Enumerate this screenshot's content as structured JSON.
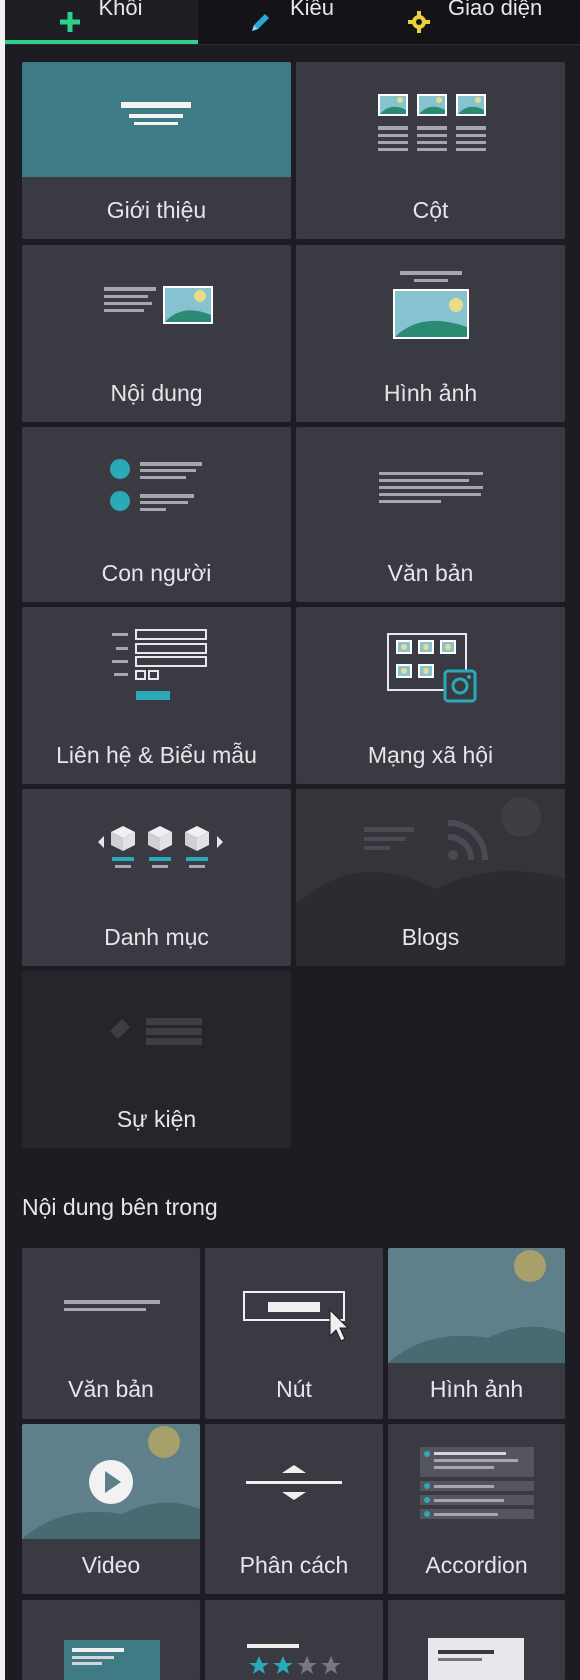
{
  "tabs": [
    {
      "label": "Khối",
      "icon": "plus-icon",
      "active": true
    },
    {
      "label": "Kiểu",
      "icon": "pencil-icon",
      "active": false
    },
    {
      "label": "Giao diện",
      "icon": "gear-icon",
      "active": false
    }
  ],
  "blocks": [
    {
      "label": "Giới thiệu"
    },
    {
      "label": "Cột"
    },
    {
      "label": "Nội dung"
    },
    {
      "label": "Hình ảnh"
    },
    {
      "label": "Con người"
    },
    {
      "label": "Văn bản"
    },
    {
      "label": "Liên hệ & Biểu mẫu"
    },
    {
      "label": "Mạng xã hội"
    },
    {
      "label": "Danh mục"
    },
    {
      "label": "Blogs"
    },
    {
      "label": "Sự kiện"
    }
  ],
  "inner": {
    "title": "Nội dung bên trong",
    "items": [
      {
        "label": "Văn bản"
      },
      {
        "label": "Nút"
      },
      {
        "label": "Hình ảnh"
      },
      {
        "label": "Video"
      },
      {
        "label": "Phân cách"
      },
      {
        "label": "Accordion"
      }
    ]
  },
  "colors": {
    "accent": "#2fd08a",
    "teal": "#2aa9b8",
    "tile_bg": "#3a3a42",
    "panel_bg": "#1c1c22"
  }
}
